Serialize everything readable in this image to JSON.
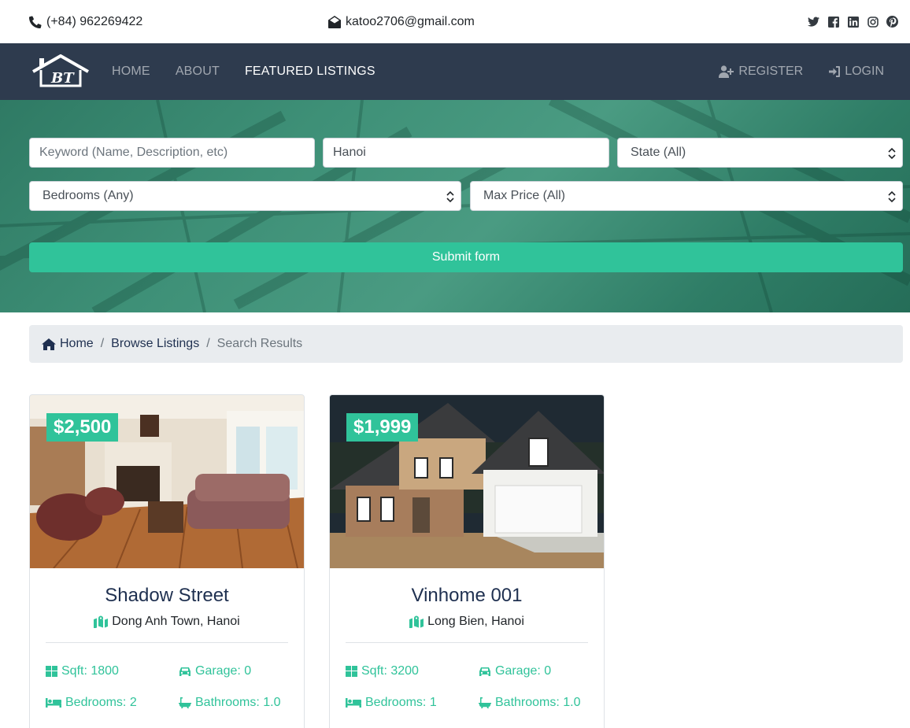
{
  "topbar": {
    "phone": "(+84) 962269422",
    "email": "katoo2706@gmail.com",
    "social": [
      "twitter-icon",
      "facebook-icon",
      "linkedin-icon",
      "instagram-icon",
      "pinterest-icon"
    ]
  },
  "nav": {
    "logo_text": "BT",
    "links": [
      {
        "label": "HOME",
        "active": false
      },
      {
        "label": "ABOUT",
        "active": false
      },
      {
        "label": "FEATURED LISTINGS",
        "active": true
      }
    ],
    "register": "REGISTER",
    "login": "LOGIN"
  },
  "search": {
    "keyword_placeholder": "Keyword (Name, Description, etc)",
    "city_value": "Hanoi",
    "state_selected": "State (All)",
    "bedrooms_selected": "Bedrooms (Any)",
    "max_price_selected": "Max Price (All)",
    "submit_label": "Submit form"
  },
  "breadcrumb": {
    "home": "Home",
    "browse": "Browse Listings",
    "current": "Search Results",
    "separator": "/"
  },
  "listings": [
    {
      "price": "$2,500",
      "title": "Shadow Street",
      "location": "Dong Anh Town, Hanoi",
      "sqft": "Sqft: 1800",
      "garage": "Garage: 0",
      "bedrooms": "Bedrooms: 2",
      "bathrooms": "Bathrooms: 1.0"
    },
    {
      "price": "$1,999",
      "title": "Vinhome 001",
      "location": "Long Bien, Hanoi",
      "sqft": "Sqft: 3200",
      "garage": "Garage: 0",
      "bedrooms": "Bedrooms: 1",
      "bathrooms": "Bathrooms: 1.0"
    }
  ],
  "colors": {
    "navbar": "#2e3b4e",
    "accent": "#30c39a",
    "breadcrumb_bg": "#e9ecef",
    "title": "#1f3050"
  }
}
